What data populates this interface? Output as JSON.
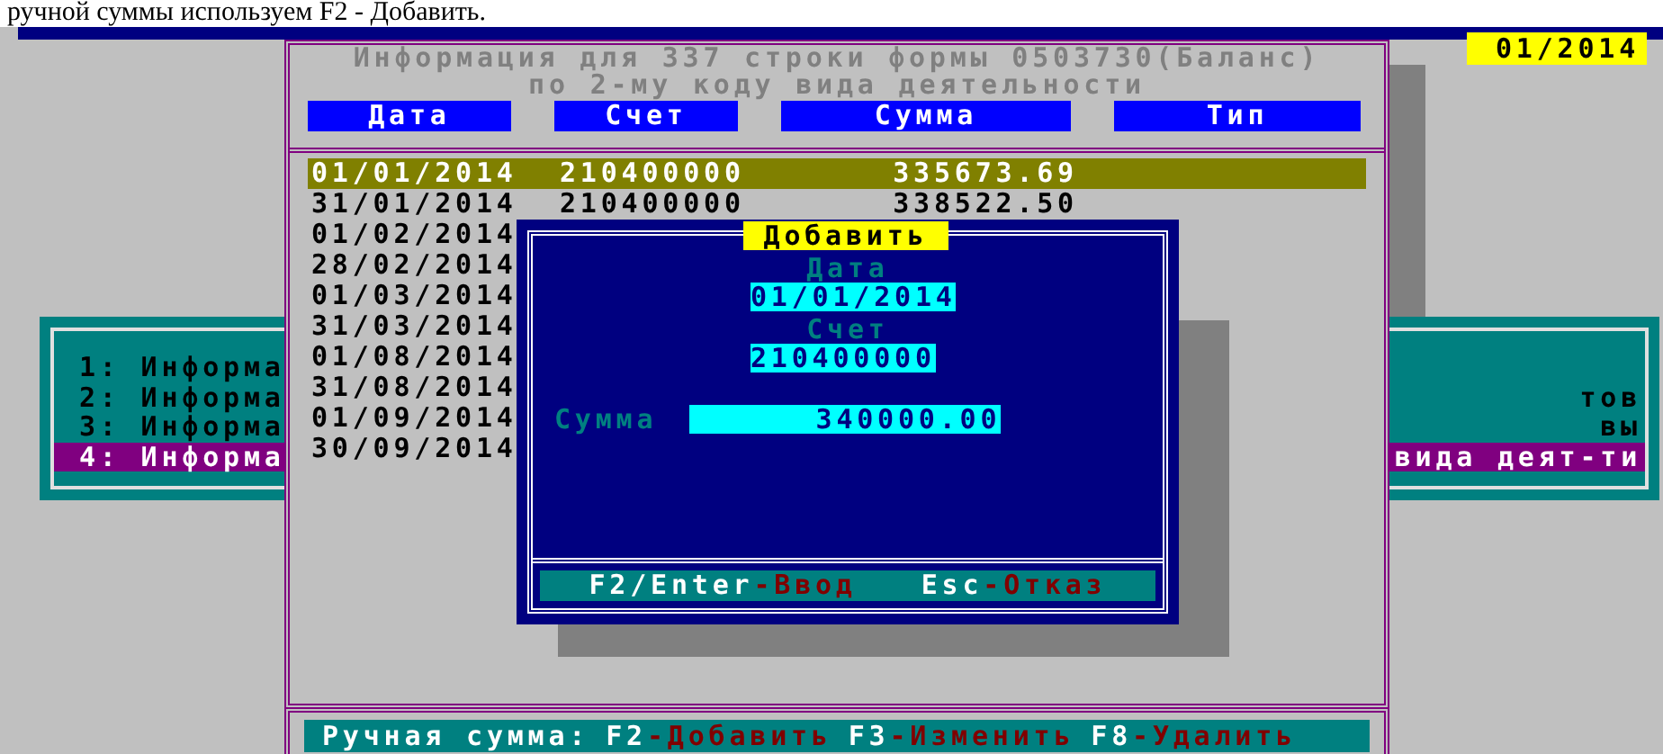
{
  "document_text": "ручной суммы используем F2 - Добавить.",
  "period": "01/2014",
  "menu_window": {
    "items": [
      {
        "left_text": "1: Информа",
        "selected": false
      },
      {
        "left_text": "2: Информа",
        "right_text": "тов",
        "selected": false
      },
      {
        "left_text": "3: Информа",
        "right_text": "вы",
        "selected": false
      },
      {
        "left_text": "4: Информа",
        "right_text": "вида деят-ти",
        "selected": true
      }
    ]
  },
  "main_window": {
    "title_lines": [
      "Информация для 337 строки формы 0503730(Баланс)",
      "по 2-му коду вида деятельности"
    ],
    "columns": [
      "Дата",
      "Счет",
      "Сумма",
      "Тип"
    ],
    "rows": [
      {
        "date": "01/01/2014",
        "account": "210400000",
        "amount": "335673.69",
        "selected": true
      },
      {
        "date": "31/01/2014",
        "account": "210400000",
        "amount": "338522.50",
        "selected": false
      },
      {
        "date": "01/02/2014",
        "selected": false
      },
      {
        "date": "28/02/2014",
        "selected": false
      },
      {
        "date": "01/03/2014",
        "selected": false
      },
      {
        "date": "31/03/2014",
        "selected": false
      },
      {
        "date": "01/08/2014",
        "selected": false
      },
      {
        "date": "31/08/2014",
        "selected": false
      },
      {
        "date": "01/09/2014",
        "selected": false
      },
      {
        "date": "30/09/2014",
        "selected": false
      }
    ]
  },
  "dialog": {
    "title": "Добавить",
    "fields": [
      {
        "kind": "stacked",
        "label": "Дата",
        "value": "01/01/2014"
      },
      {
        "kind": "stacked",
        "label": "Счет",
        "value": "210400000"
      },
      {
        "kind": "inline",
        "label": "Сумма",
        "value": "340000.00"
      }
    ],
    "keys": [
      {
        "key": "F2/Enter",
        "action": "-Ввод"
      },
      {
        "key": "Esc",
        "action": "-Отказ"
      }
    ]
  },
  "hint_bar": {
    "label": "Ручная сумма:",
    "keys": [
      {
        "key": "F2",
        "action": "-Добавить"
      },
      {
        "key": "F3",
        "action": "-Изменить"
      },
      {
        "key": "F8",
        "action": "-Удалить"
      }
    ]
  }
}
